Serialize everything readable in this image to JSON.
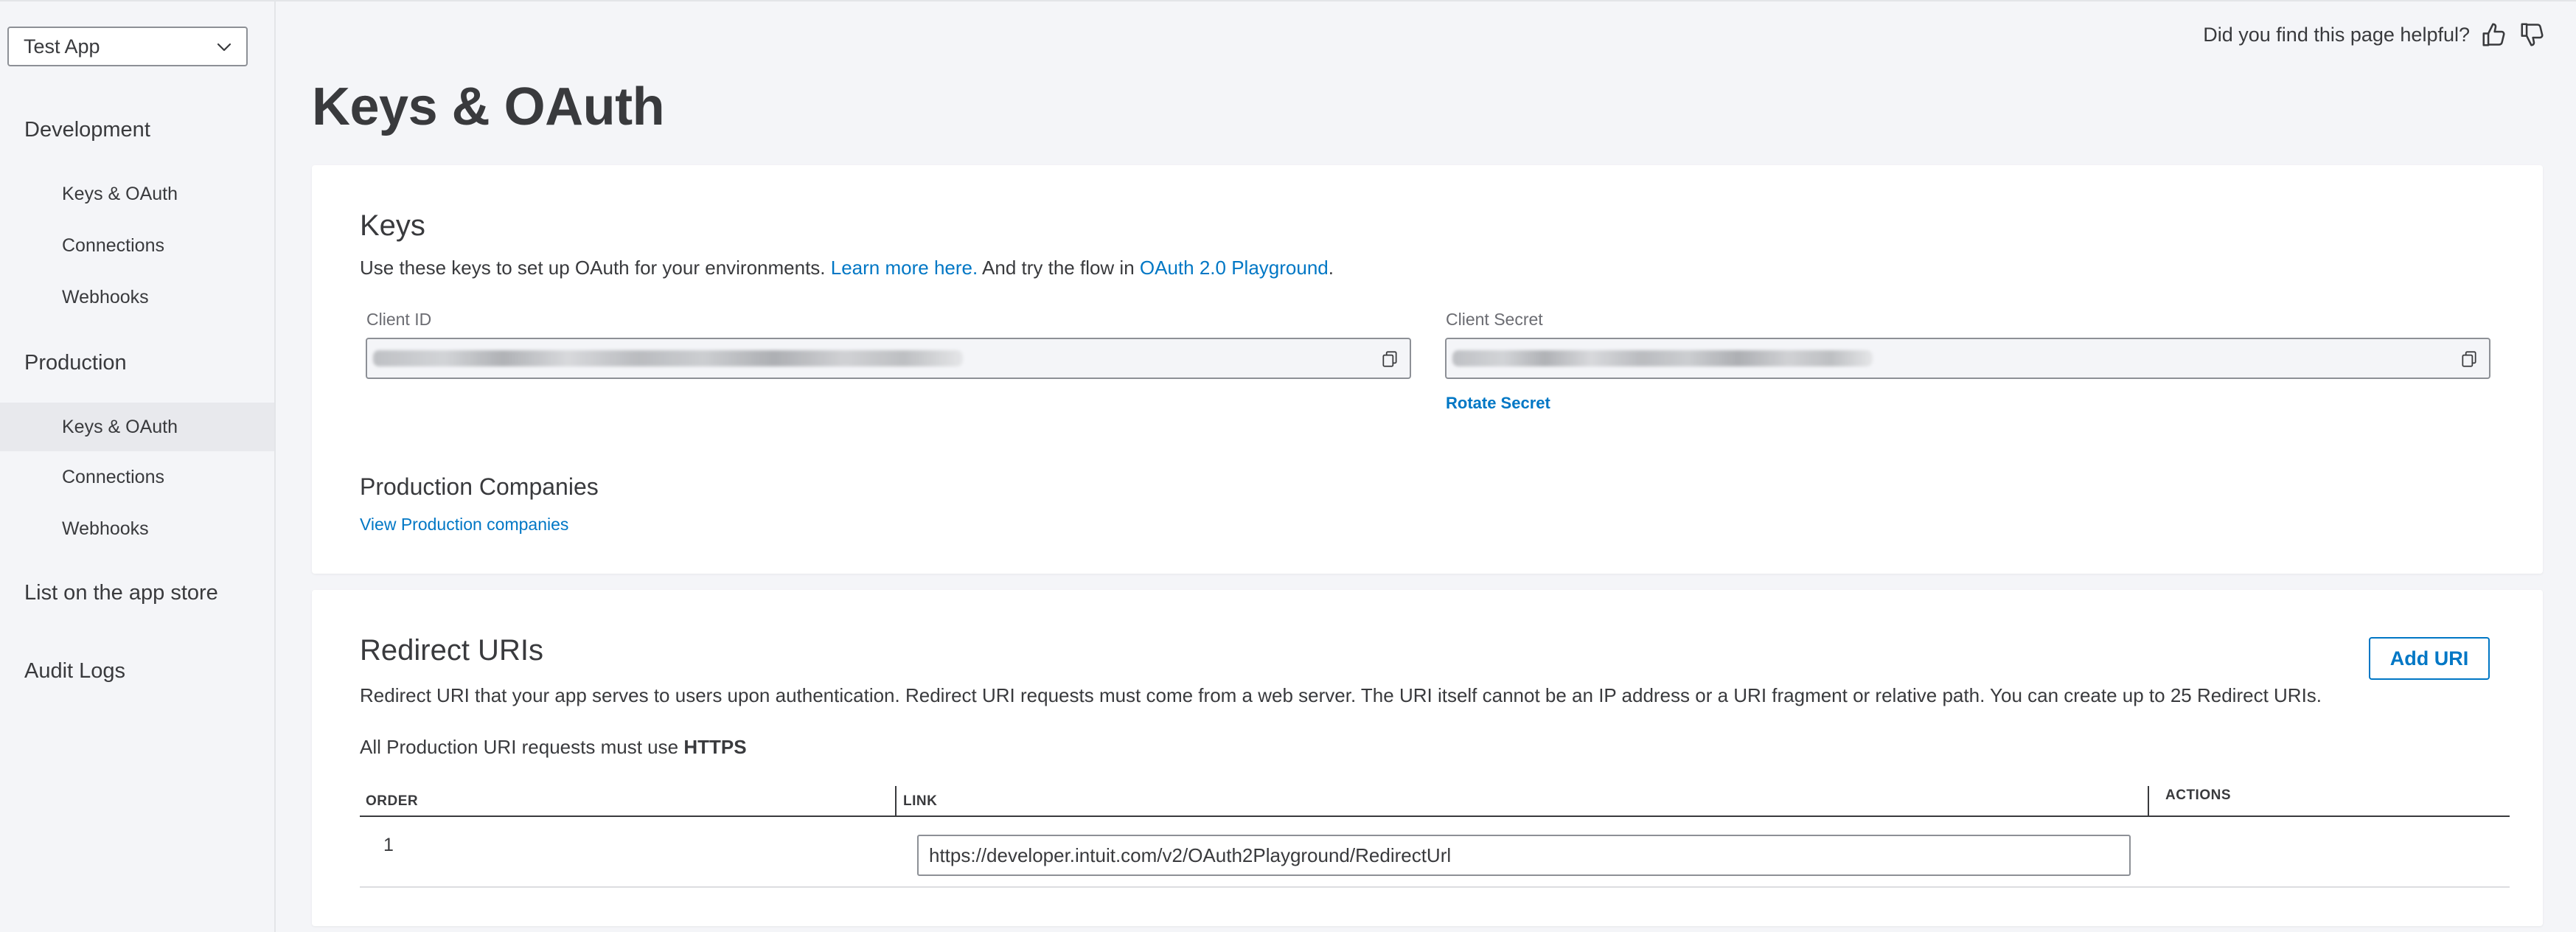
{
  "sidebar": {
    "app_selector": "Test App",
    "sections": [
      {
        "label": "Development",
        "items": [
          "Keys & OAuth",
          "Connections",
          "Webhooks"
        ]
      },
      {
        "label": "Production",
        "items": [
          "Keys & OAuth",
          "Connections",
          "Webhooks"
        ]
      }
    ],
    "list_on_app_store": "List on the app store",
    "audit_logs": "Audit Logs"
  },
  "header": {
    "helpful_text": "Did you find this page helpful?",
    "page_title": "Keys & OAuth"
  },
  "keys": {
    "title": "Keys",
    "desc_prefix": "Use these keys to set up OAuth for your environments.",
    "learn_more": "Learn more here.",
    "desc_middle": "And try the flow in",
    "playground": "OAuth 2.0 Playground",
    "desc_suffix": ".",
    "client_id_label": "Client ID",
    "client_secret_label": "Client Secret",
    "rotate_secret": "Rotate Secret",
    "companies_title": "Production Companies",
    "view_companies": "View Production companies"
  },
  "redirect": {
    "title": "Redirect URIs",
    "add_uri": "Add URI",
    "description": "Redirect URI that your app serves to users upon authentication. Redirect URI requests must come from a web server. The URI itself cannot be an IP address or a URI fragment or relative path. You can create up to 25 Redirect URIs.",
    "https_prefix": "All Production URI requests must use",
    "https_word": "HTTPS",
    "columns": {
      "order": "ORDER",
      "link": "LINK",
      "actions": "ACTIONS"
    },
    "rows": [
      {
        "order": "1",
        "link": "https://developer.intuit.com/v2/OAuth2Playground/RedirectUrl"
      }
    ]
  },
  "colors": {
    "link": "#0077c5",
    "text": "#393a3d",
    "background": "#f4f5f8"
  },
  "icons": [
    "chevron-down-icon",
    "thumbs-up-icon",
    "thumbs-down-icon",
    "copy-icon"
  ]
}
